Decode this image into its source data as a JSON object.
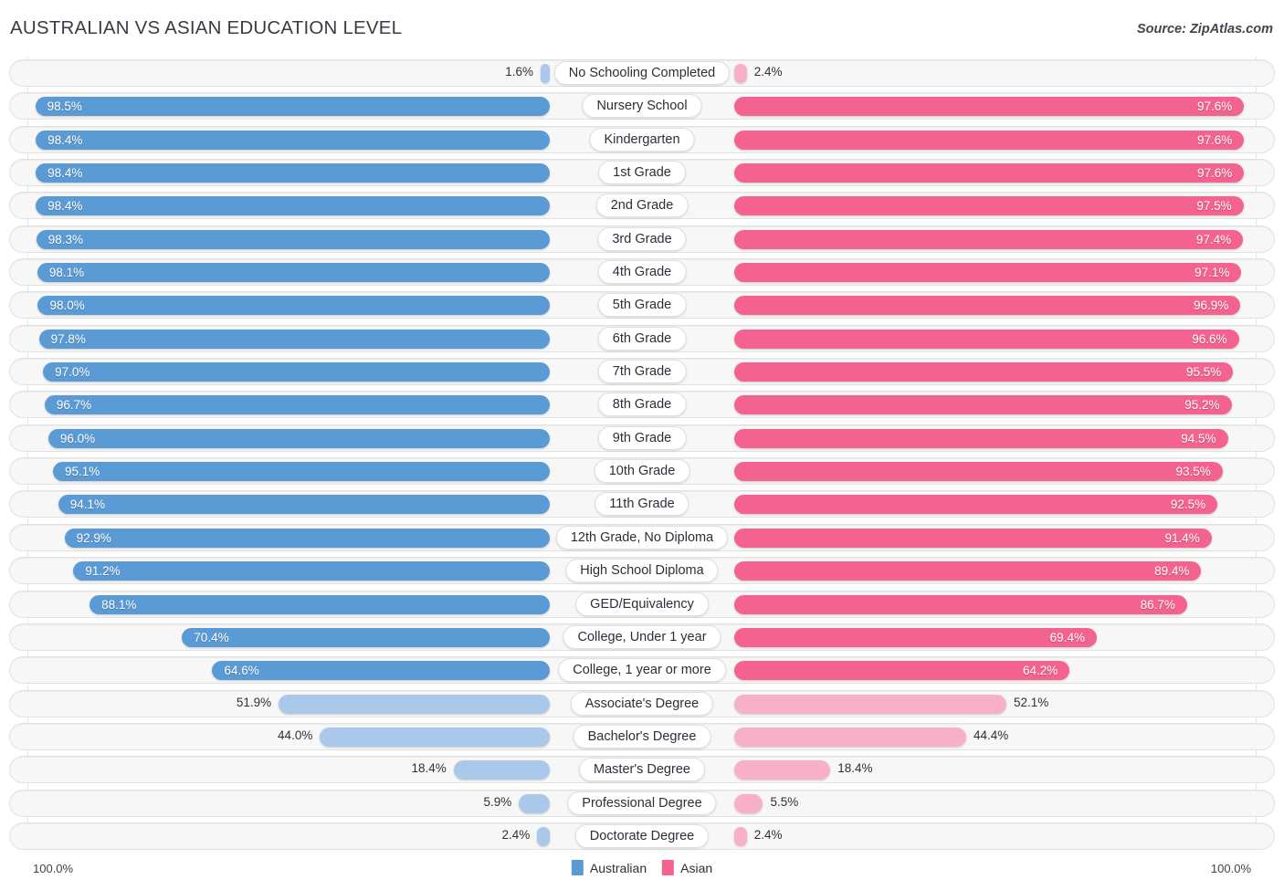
{
  "header": {
    "title": "AUSTRALIAN VS ASIAN EDUCATION LEVEL",
    "source": "Source: ZipAtlas.com"
  },
  "footer": {
    "axis_left": "100.0%",
    "axis_right": "100.0%",
    "legend": [
      {
        "label": "Australian",
        "color": "#5b9bd5"
      },
      {
        "label": "Asian",
        "color": "#f4628f"
      }
    ]
  },
  "colors": {
    "australian_dark": "#5b9bd5",
    "australian_light": "#a9c8ea",
    "asian_dark": "#f4628f",
    "asian_light": "#f8b0c9",
    "track": "#f7f7f7",
    "track_border": "#e2e2e2",
    "text_dark": "#2f2f38"
  },
  "chart_data": {
    "type": "bar",
    "subtype": "diverging-paired-bars",
    "title": "AUSTRALIAN VS ASIAN EDUCATION LEVEL",
    "xlabel": "",
    "ylabel": "",
    "xlim": [
      0,
      100
    ],
    "axis_max_label": "100.0%",
    "grid": true,
    "legend_position": "bottom-center",
    "categories": [
      "No Schooling Completed",
      "Nursery School",
      "Kindergarten",
      "1st Grade",
      "2nd Grade",
      "3rd Grade",
      "4th Grade",
      "5th Grade",
      "6th Grade",
      "7th Grade",
      "8th Grade",
      "9th Grade",
      "10th Grade",
      "11th Grade",
      "12th Grade, No Diploma",
      "High School Diploma",
      "GED/Equivalency",
      "College, Under 1 year",
      "College, 1 year or more",
      "Associate's Degree",
      "Bachelor's Degree",
      "Master's Degree",
      "Professional Degree",
      "Doctorate Degree"
    ],
    "series": [
      {
        "name": "Australian",
        "side": "left",
        "color": "#5b9bd5",
        "values": [
          1.6,
          98.5,
          98.4,
          98.4,
          98.4,
          98.3,
          98.1,
          98.0,
          97.8,
          97.0,
          96.7,
          96.0,
          95.1,
          94.1,
          92.9,
          91.2,
          88.1,
          70.4,
          64.6,
          51.9,
          44.0,
          18.4,
          5.9,
          2.4
        ],
        "labels": [
          "1.6%",
          "98.5%",
          "98.4%",
          "98.4%",
          "98.4%",
          "98.3%",
          "98.1%",
          "98.0%",
          "97.8%",
          "97.0%",
          "96.7%",
          "96.0%",
          "95.1%",
          "94.1%",
          "92.9%",
          "91.2%",
          "88.1%",
          "70.4%",
          "64.6%",
          "51.9%",
          "44.0%",
          "18.4%",
          "5.9%",
          "2.4%"
        ]
      },
      {
        "name": "Asian",
        "side": "right",
        "color": "#f4628f",
        "values": [
          2.4,
          97.6,
          97.6,
          97.6,
          97.5,
          97.4,
          97.1,
          96.9,
          96.6,
          95.5,
          95.2,
          94.5,
          93.5,
          92.5,
          91.4,
          89.4,
          86.7,
          69.4,
          64.2,
          52.1,
          44.4,
          18.4,
          5.5,
          2.4
        ],
        "labels": [
          "2.4%",
          "97.6%",
          "97.6%",
          "97.6%",
          "97.5%",
          "97.4%",
          "97.1%",
          "96.9%",
          "96.6%",
          "95.5%",
          "95.2%",
          "94.5%",
          "93.5%",
          "92.5%",
          "91.4%",
          "89.4%",
          "86.7%",
          "69.4%",
          "64.2%",
          "52.1%",
          "44.4%",
          "18.4%",
          "5.5%",
          "2.4%"
        ]
      }
    ]
  }
}
